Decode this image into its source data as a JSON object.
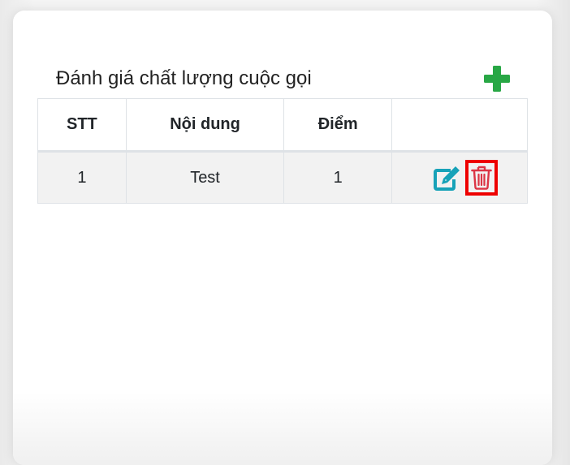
{
  "panel": {
    "title": "Đánh giá chất lượng cuộc gọi",
    "add_icon": "plus-icon",
    "add_color": "#28a745"
  },
  "table": {
    "columns": [
      "STT",
      "Nội dung",
      "Điểm",
      ""
    ],
    "rows": [
      {
        "stt": "1",
        "content": "Test",
        "score": "1"
      }
    ]
  },
  "icons": {
    "edit": "edit-icon",
    "edit_color": "#17a2b8",
    "delete": "trash-icon",
    "delete_color": "#dc3545",
    "highlight_color": "#ee0000"
  }
}
